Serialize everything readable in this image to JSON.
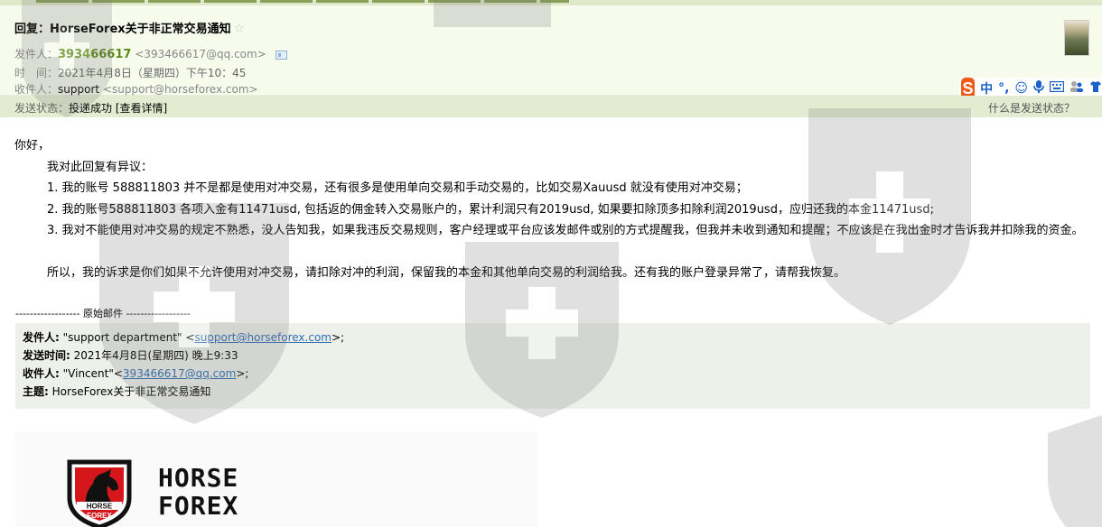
{
  "subject": "回复：HorseForex关于非正常交易通知",
  "header": {
    "from_label": "发件人：",
    "from_name": "393466617",
    "from_addr": "<393466617@qq.com>",
    "time_label": "时　间：",
    "time_value": "2021年4月8日（星期四）下午10：45",
    "to_label": "收件人：",
    "to_name": "support",
    "to_addr": "<support@horseforex.com>"
  },
  "status": {
    "label": "发送状态：",
    "value": "投递成功",
    "detail_link": "[查看详情]",
    "help_link": "什么是发送状态？"
  },
  "ime": {
    "items": [
      "中",
      "°,",
      "☺",
      "🎤",
      "⌨",
      "👥",
      "👕"
    ]
  },
  "message": {
    "greeting": "你好，",
    "intro": "我对此回复有异议：",
    "point1": "1. 我的账号 588811803 并不是都是使用对冲交易，还有很多是使用单向交易和手动交易的，比如交易Xauusd 就没有使用对冲交易；",
    "point2": "2. 我的账号588811803 各项入金有11471usd, 包括返的佣金转入交易账户的，累计利润只有2019usd, 如果要扣除顶多扣除利润2019usd，应归还我的本金11471usd;",
    "point3": "3. 我对不能使用对冲交易的规定不熟悉，没人告知我，如果我违反交易规则，客户经理或平台应该发邮件或别的方式提醒我，但我并未收到通知和提醒；不应该是在我出金时才告诉我并扣除我的资金。",
    "closing": "所以，我的诉求是你们如果不允许使用对冲交易，请扣除对冲的利润，保留我的本金和其他单向交易的利润给我。还有我的账户登录异常了，请帮我恢复。"
  },
  "original": {
    "divider": "------------------ 原始邮件 ------------------",
    "from_label": "发件人:",
    "from_value_prefix": "\"support department\" <",
    "from_link": "support@horseforex.com",
    "from_value_suffix": ">;",
    "time_label": "发送时间:",
    "time_value": "2021年4月8日(星期四) 晚上9:33",
    "to_label": "收件人:",
    "to_value_prefix": "\"Vincent\"<",
    "to_link": "393466617@qq.com",
    "to_value_suffix": ">;",
    "subject_label": "主题:",
    "subject_value": "HorseForex关于非正常交易通知"
  },
  "brand": {
    "line1": "HORSE",
    "line2": "FOREX",
    "shield_text1": "HORSE",
    "shield_text2": "FOREX"
  },
  "colors": {
    "header_bg": "#f7fbec",
    "status_bg": "#e3ecd0",
    "sender_green": "#5c8a1a",
    "link_blue": "#2f6db5",
    "ime_orange": "#ef5a16",
    "brand_red": "#d5161b"
  }
}
